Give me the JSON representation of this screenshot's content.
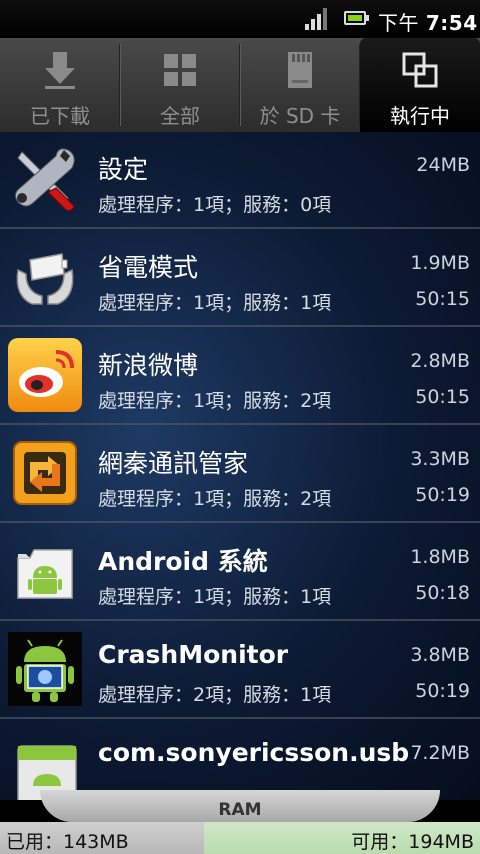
{
  "status_bar": {
    "time_prefix": "下午",
    "time": "7:54"
  },
  "tabs": [
    {
      "label": "已下載",
      "icon": "download-icon",
      "active": false
    },
    {
      "label": "全部",
      "icon": "grid-icon",
      "active": false
    },
    {
      "label": "於 SD 卡",
      "icon": "sd-card-icon",
      "active": false
    },
    {
      "label": "執行中",
      "icon": "running-apps-icon",
      "active": true
    }
  ],
  "apps": [
    {
      "name": "設定",
      "detail": "處理程序：1項；服務：0項",
      "size": "24MB",
      "time": "",
      "icon": "settings-tools-icon"
    },
    {
      "name": "省電模式",
      "detail": "處理程序：1項；服務：1項",
      "size": "1.9MB",
      "time": "50:15",
      "icon": "power-saver-icon"
    },
    {
      "name": "新浪微博",
      "detail": "處理程序：1項；服務：2項",
      "size": "2.8MB",
      "time": "50:15",
      "icon": "weibo-icon"
    },
    {
      "name": "網秦通訊管家",
      "detail": "處理程序：1項；服務：2項",
      "size": "3.3MB",
      "time": "50:19",
      "icon": "netqin-icon"
    },
    {
      "name": "Android 系統",
      "detail": "處理程序：1項；服務：1項",
      "size": "1.8MB",
      "time": "50:18",
      "icon": "android-system-icon"
    },
    {
      "name": "CrashMonitor",
      "detail": "處理程序：2項；服務：1項",
      "size": "3.8MB",
      "time": "50:19",
      "icon": "crash-monitor-icon"
    },
    {
      "name": "com.sonyericsson.usbux",
      "detail": "",
      "size": "7.2MB",
      "time": "",
      "icon": "android-usb-icon"
    }
  ],
  "ram": {
    "label": "RAM",
    "used": "已用：143MB",
    "free": "可用：194MB",
    "used_fraction": 0.424
  }
}
